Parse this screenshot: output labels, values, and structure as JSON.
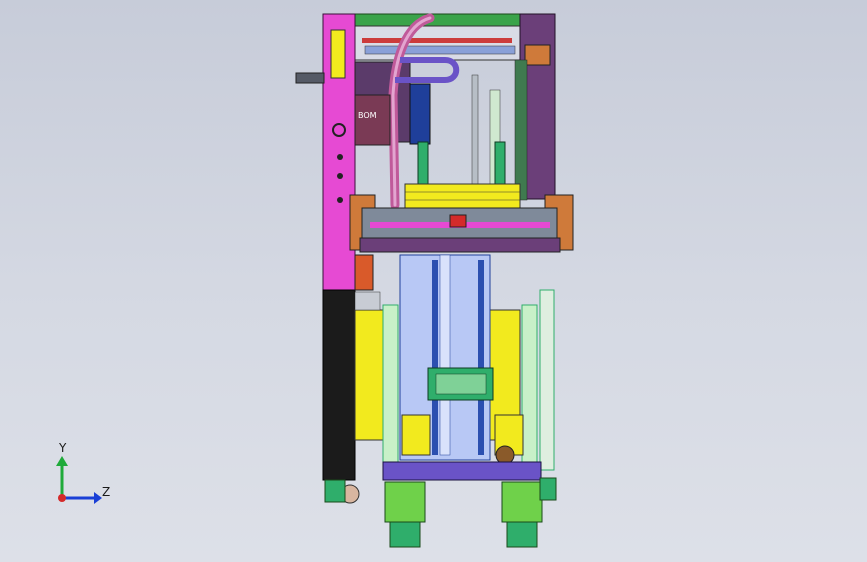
{
  "viewport": {
    "background_top": "#c7ccd9",
    "background_bottom": "#dde0e8"
  },
  "triad": {
    "y_label": "Y",
    "z_label": "Z",
    "y_color": "#1faa3a",
    "z_color": "#1a3fd6",
    "x_color": "#d42a2a"
  },
  "model": {
    "part_labels": [
      "BOM"
    ],
    "colors": {
      "magenta_panel": "#e64ad3",
      "frame_purple": "#6b3f79",
      "yellow_plate": "#f2ea1e",
      "blue_column": "#b8c8f5",
      "black_base": "#1b1b1b",
      "orange_brace": "#cf7a3a",
      "green_guide": "#2fae6b",
      "pink_cable": "#c05a9a",
      "lime_feet": "#6fd14a"
    }
  }
}
